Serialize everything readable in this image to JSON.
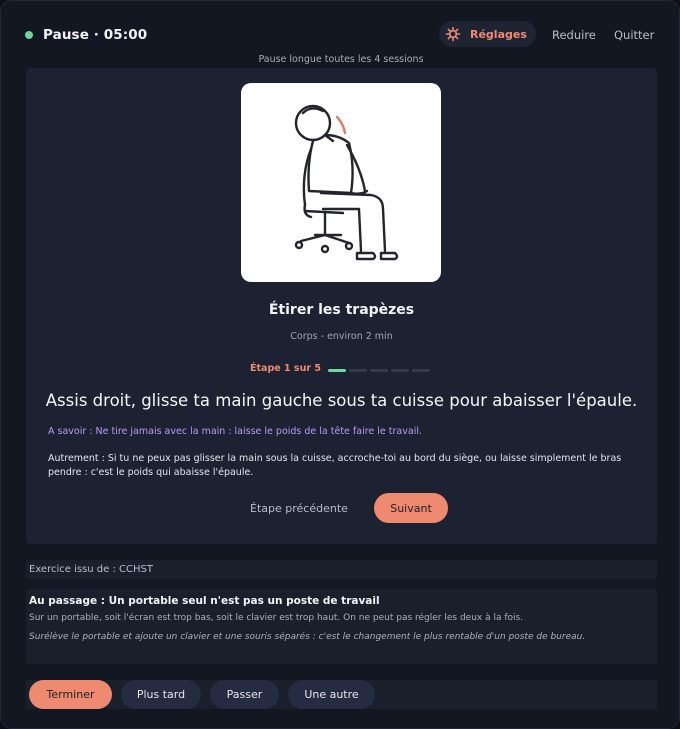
{
  "header": {
    "title": "Pause · 05:00",
    "settings_label": "Réglages",
    "reduce_label": "Reduire",
    "quit_label": "Quitter",
    "subtitle": "Pause longue toutes les 4 sessions",
    "status_color": "#6fd39a"
  },
  "exercise": {
    "illustration": "person-stretching-neck-on-office-chair",
    "title": "Étirer les trapèzes",
    "meta": "Corps - environ 2 min",
    "step_label": "Étape 1 sur 5",
    "step_current": 1,
    "step_total": 5,
    "instruction": "Assis droit, glisse ta main gauche sous ta cuisse pour abaisser l'épaule.",
    "note": "A savoir : Ne tire jamais avec la main : laisse le poids de la tête faire le travail.",
    "alternative": "Autrement : Si tu ne peux pas glisser la main sous la cuisse, accroche-toi au bord du siège, ou laisse simplement le bras pendre : c'est le poids qui abaisse l'épaule.",
    "prev_label": "Étape précédente",
    "next_label": "Suivant"
  },
  "source": {
    "text": "Exercice issu de : CCHST"
  },
  "tip": {
    "title": "Au passage : Un portable seul n'est pas un poste de travail",
    "body": "Sur un portable, soit l'écran est trop bas, soit le clavier est trop haut. On ne peut pas régler les deux à la fois.",
    "advice": "Surélève le portable et ajoute un clavier et une souris séparés : c'est le changement le plus rentable d'un poste de bureau."
  },
  "footer": {
    "finish_label": "Terminer",
    "later_label": "Plus tard",
    "skip_label": "Passer",
    "another_label": "Une autre"
  },
  "colors": {
    "accent": "#ee8a70",
    "progress_active": "#74d6a0",
    "note": "#b89cf6",
    "background": "#121722",
    "card": "#1c2231"
  }
}
